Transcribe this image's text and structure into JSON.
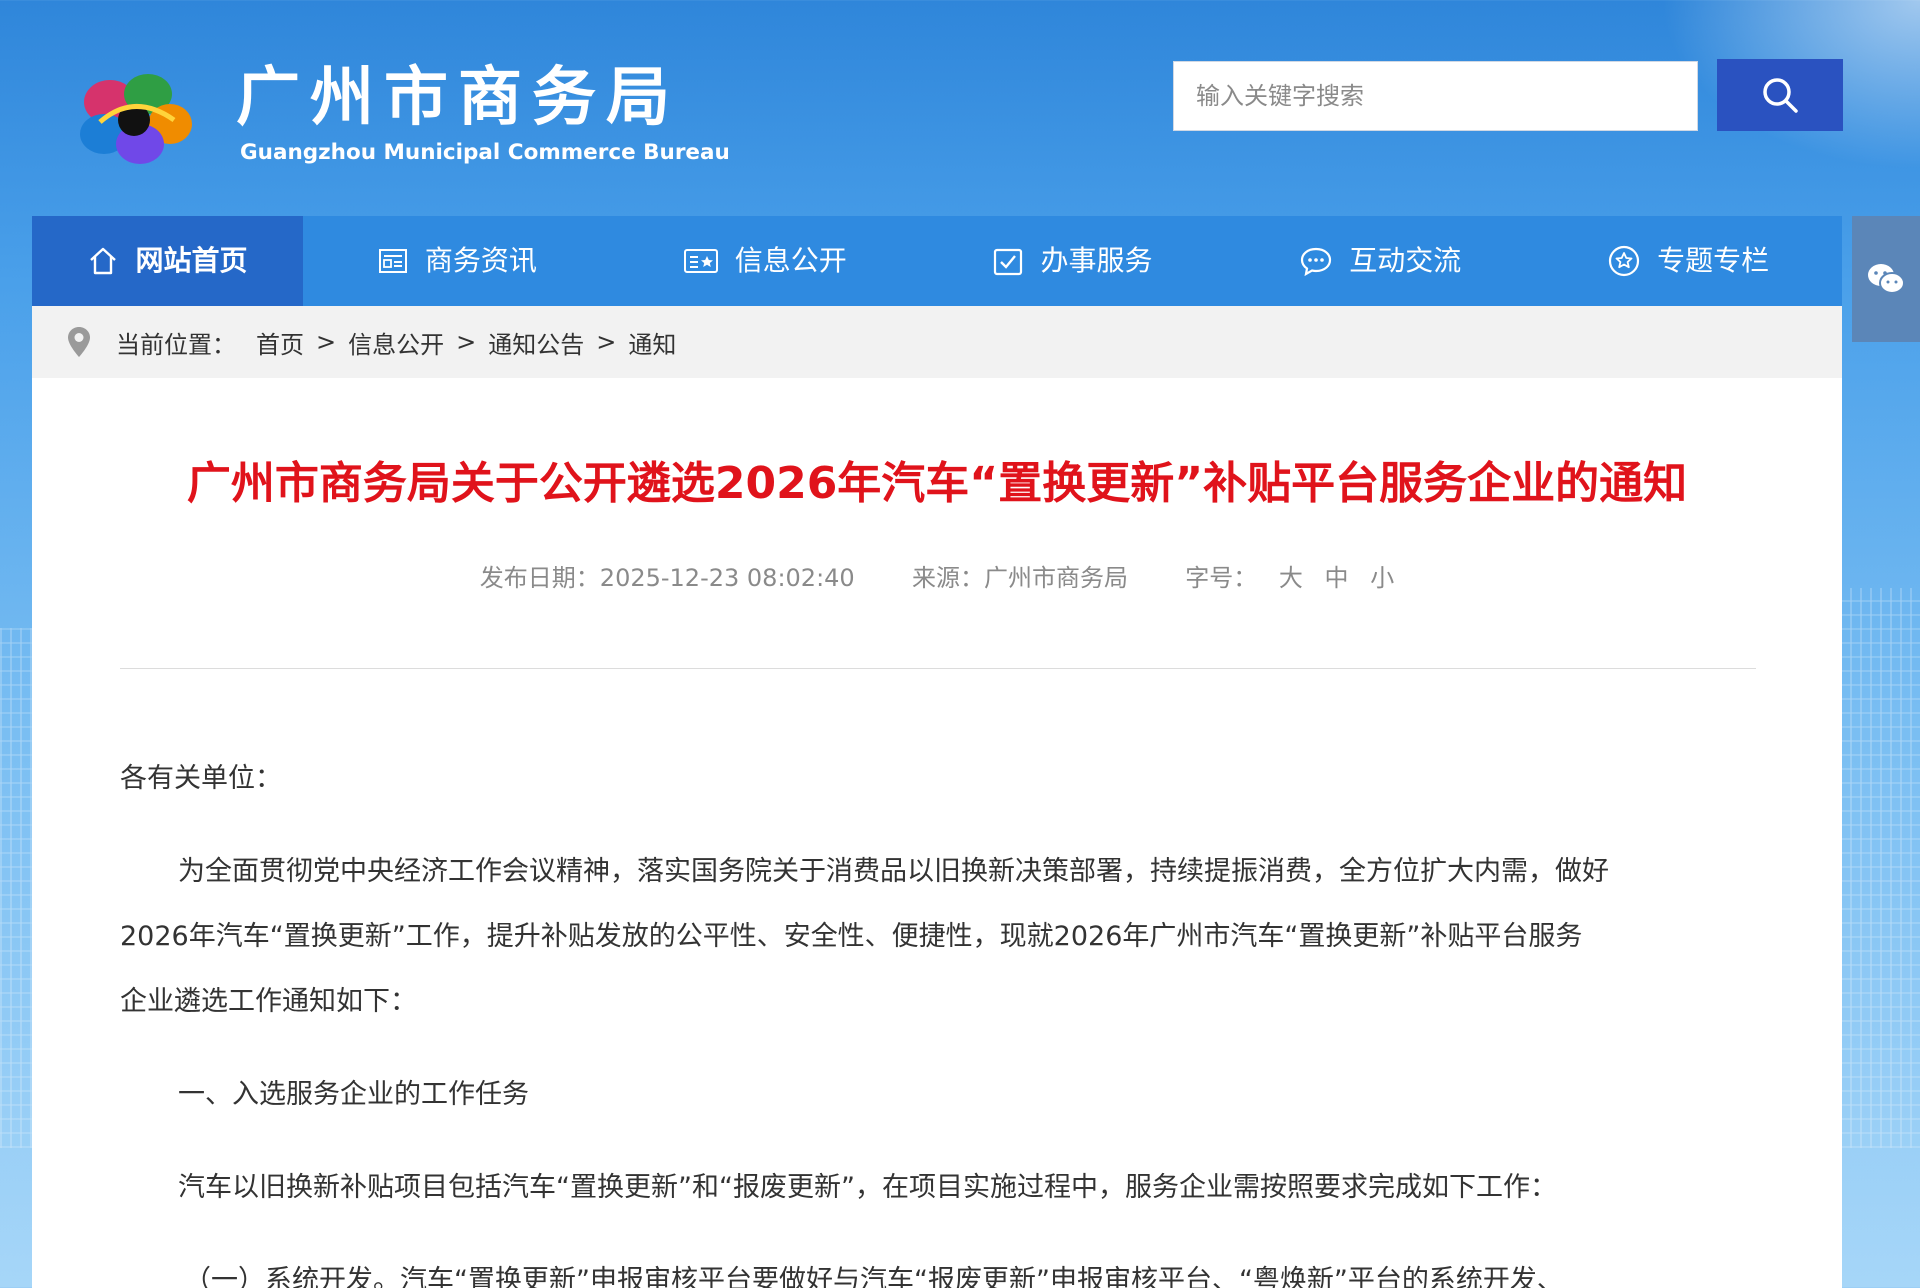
{
  "header": {
    "site_name_cn": "广州市商务局",
    "site_name_en": "Guangzhou Municipal Commerce Bureau",
    "search_placeholder": "输入关键字搜索"
  },
  "nav": {
    "items": [
      {
        "label": "网站首页",
        "icon": "home-icon",
        "active": true
      },
      {
        "label": "商务资讯",
        "icon": "news-icon"
      },
      {
        "label": "信息公开",
        "icon": "info-card-icon"
      },
      {
        "label": "办事服务",
        "icon": "checkbox-icon"
      },
      {
        "label": "互动交流",
        "icon": "chat-bubble-icon"
      },
      {
        "label": "专题专栏",
        "icon": "star-badge-icon"
      }
    ]
  },
  "side_tab": {
    "icon": "wechat-icon"
  },
  "breadcrumb": {
    "label": "当前位置：",
    "items": [
      "首页",
      "信息公开",
      "通知公告",
      "通知"
    ],
    "separator": ">"
  },
  "article": {
    "title": "广州市商务局关于公开遴选2026年汽车“置换更新”补贴平台服务企业的通知",
    "publish_label": "发布日期：",
    "publish_date": "2025-12-23 08:02:40",
    "source_label": "来源：",
    "source": "广州市商务局",
    "font_size_label": "字号：",
    "font_sizes": [
      "大",
      "中",
      "小"
    ],
    "paragraphs": [
      "各有关单位：",
      "为全面贯彻党中央经济工作会议精神，落实国务院关于消费品以旧换新决策部署，持续提振消费，全方位扩大内需，做好",
      "2026年汽车“置换更新”工作，提升补贴发放的公平性、安全性、便捷性，现就2026年广州市汽车“置换更新”补贴平台服务",
      "企业遴选工作通知如下：",
      "一、入选服务企业的工作任务",
      "汽车以旧换新补贴项目包括汽车“置换更新”和“报废更新”，在项目实施过程中，服务企业需按照要求完成如下工作：",
      "（一）系统开发。汽车“置换更新”申报审核平台要做好与汽车“报废更新”申报审核平台、“粤焕新”平台的系统开发、"
    ]
  },
  "colors": {
    "nav_bg": "#2f8ae0",
    "nav_active": "#2568c8",
    "title_red": "#e0131b",
    "search_btn": "#2a52c0"
  }
}
